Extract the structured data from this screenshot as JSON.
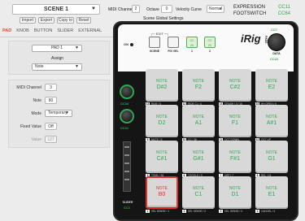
{
  "scene": {
    "name": "SCENE 1",
    "buttons": [
      "Import",
      "Export",
      "Copy to",
      "Reset"
    ]
  },
  "midi": {
    "channel_label": "MIDI Channel",
    "channel_value": "2",
    "octave_label": "Octave",
    "octave_value": "0",
    "velocity_label": "Velocity Curve",
    "velocity_value": "Normal",
    "global_settings": "Scene Global Settings"
  },
  "external": [
    {
      "label": "EXPRESSION",
      "value": "CC11"
    },
    {
      "label": "FOOTSWITCH",
      "value": "CC64"
    }
  ],
  "tabs": [
    "PAD",
    "KNOB",
    "BUTTON",
    "SLIDER",
    "EXTERNAL"
  ],
  "pad_panel": {
    "pad_select": "PAD 1",
    "assign_label": "Assign",
    "assign_value": "Note"
  },
  "pad_settings": {
    "channel_label": "MIDI Channel",
    "channel_value": "3",
    "note_label": "Note",
    "note_value": "80",
    "mode_label": "Mode",
    "mode_value": "Temporary",
    "velocity_label": "Fixed Value",
    "velocity_value": "Off",
    "value_label": "Value",
    "value_value": "127"
  },
  "device": {
    "on_label": "ON",
    "edit_label": "EDIT",
    "scene_label": "SCENE",
    "fix_vel_label": "FIX VEL",
    "cc_buttons": [
      {
        "cc": "CC",
        "num": "20",
        "idx": "1"
      },
      {
        "cc": "CC",
        "num": "21",
        "idx": "2"
      }
    ],
    "brand": "iRig",
    "brand_sub": "PADS",
    "knob_top_cc": "CC7",
    "data_label": "DATA",
    "data_cc": "CC22",
    "knob1_cc": "CC10",
    "knob2_cc": "CC11",
    "slider_label": "SLIDER",
    "slider_cc": "CC1",
    "pads": [
      {
        "num": "13",
        "note": "NOTE",
        "name": "D#2",
        "cap": "RIDE / 6"
      },
      {
        "num": "14",
        "note": "NOTE",
        "name": "F2",
        "cap": "RIDE CL / 4"
      },
      {
        "num": "15",
        "note": "NOTE",
        "name": "C#2",
        "cap": "CRASH / 3 / 16"
      },
      {
        "num": "16",
        "note": "NOTE",
        "name": "E2",
        "cap": "HH OPEN / 5"
      },
      {
        "num": "9",
        "note": "NOTE",
        "name": "D2",
        "cap": "MUTE / 5"
      },
      {
        "num": "10",
        "note": "NOTE",
        "name": "A1",
        "cap": "CC / 38"
      },
      {
        "num": "11",
        "note": "NOTE",
        "name": "F1",
        "cap": "OCT DOWN"
      },
      {
        "num": "12",
        "note": "NOTE",
        "name": "A#1",
        "cap": "OCT UP"
      },
      {
        "num": "5",
        "note": "NOTE",
        "name": "C#1",
        "cap": "TOM1 / 36"
      },
      {
        "num": "6",
        "note": "NOTE",
        "name": "G#1",
        "cap": "TOGGLE / 9"
      },
      {
        "num": "7",
        "note": "NOTE",
        "name": "F#1",
        "cap": "ARP / 7"
      },
      {
        "num": "8",
        "note": "NOTE",
        "name": "G1",
        "cap": "REL / 15"
      },
      {
        "num": "1",
        "note": "NOTE",
        "name": "B0",
        "cap": "VEL SENSE / 1"
      },
      {
        "num": "2",
        "note": "NOTE",
        "name": "C1",
        "cap": "VEL SENSE / 2"
      },
      {
        "num": "3",
        "note": "NOTE",
        "name": "D1",
        "cap": "VEL SENSE / 3"
      },
      {
        "num": "4",
        "note": "NOTE",
        "name": "E1",
        "cap": "CANCEL / 4"
      }
    ]
  }
}
